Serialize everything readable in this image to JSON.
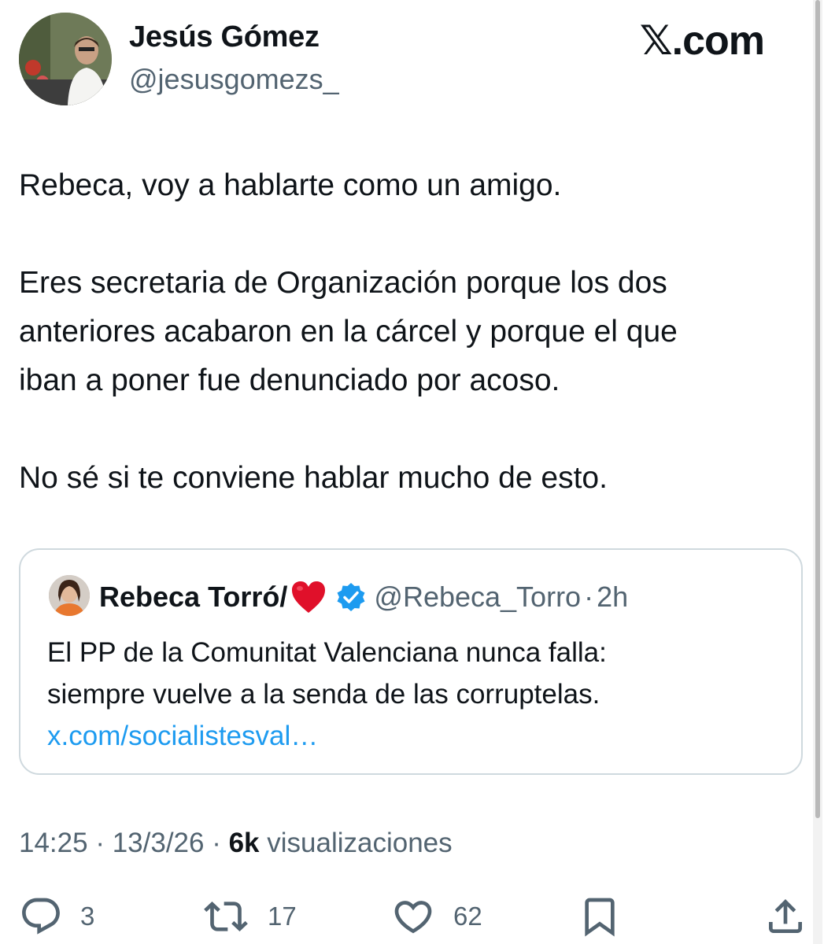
{
  "author": {
    "name": "Jesús Gómez",
    "handle": "@jesusgomezs_"
  },
  "site_logo": "𝕏.com",
  "tweet": {
    "paragraphs": [
      "Rebeca, voy a hablarte como un amigo.",
      "Eres secretaria de Organización porque los dos",
      "anteriores acabaron en la cárcel y porque el que",
      "iban a poner fue denunciado por acoso.",
      "No sé si te conviene hablar mucho de esto."
    ]
  },
  "quote": {
    "name": "Rebeca Torró/",
    "handle": "@Rebeca_Torro",
    "separator": "·",
    "time": "2h",
    "text_lines": [
      "El PP de la Comunitat Valenciana nunca falla:",
      "siempre vuelve a la senda de las corruptelas."
    ],
    "link": "x.com/socialistesval…"
  },
  "meta": {
    "time": "14:25",
    "sep1": " · ",
    "date": "13/3/26",
    "sep2": " · ",
    "views_count": "6k",
    "views_label": " visualizaciones"
  },
  "actions": {
    "replies": "3",
    "reposts": "17",
    "likes": "62"
  },
  "colors": {
    "text": "#0f1419",
    "secondary": "#536471",
    "link": "#1d9bf0",
    "verified": "#1d9bf0",
    "heart": "#e0102a",
    "border": "#cfd9de"
  }
}
